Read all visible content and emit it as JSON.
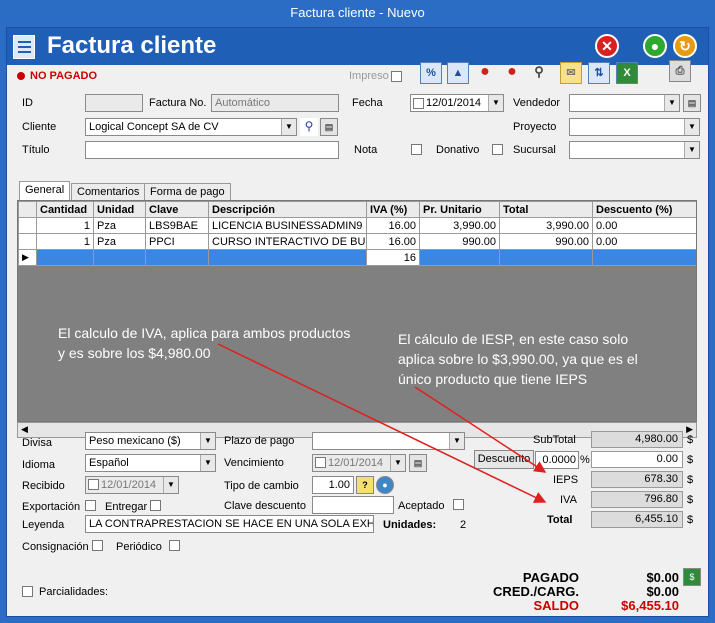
{
  "window": {
    "title": "Factura cliente - Nuevo"
  },
  "header": {
    "title": "Factura cliente",
    "close_glyph": "✕",
    "ok_glyph": "●",
    "refresh_glyph": "↻"
  },
  "status": {
    "label": "NO PAGADO",
    "color": "#cc0000"
  },
  "toolbar": {
    "impreso_label": "Impreso",
    "icons": [
      "percent-icon",
      "upload-icon",
      "red-ball-icon",
      "red-ball-icon",
      "binoculars-icon",
      "mail-icon",
      "transfer-icon",
      "excel-icon",
      "printer-icon"
    ]
  },
  "form": {
    "id_label": "ID",
    "id_value": "",
    "factura_no_label": "Factura No.",
    "factura_no_placeholder": "Automático",
    "fecha_label": "Fecha",
    "fecha_value": "12/01/2014",
    "vendedor_label": "Vendedor",
    "vendedor_value": "",
    "cliente_label": "Cliente",
    "cliente_value": "Logical Concept SA de CV",
    "proyecto_label": "Proyecto",
    "proyecto_value": "",
    "titulo_label": "Título",
    "titulo_value": "",
    "nota_label": "Nota",
    "donativo_label": "Donativo",
    "sucursal_label": "Sucursal",
    "sucursal_value": ""
  },
  "tabs": [
    {
      "label": "General"
    },
    {
      "label": "Comentarios"
    },
    {
      "label": "Forma de pago"
    }
  ],
  "grid": {
    "columns": [
      "Cantidad",
      "Unidad",
      "Clave",
      "Descripción",
      "IVA (%)",
      "Pr. Unitario",
      "Total",
      "Descuento (%)"
    ],
    "rows": [
      [
        "1",
        "Pza",
        "LBS9BAE",
        "LICENCIA BUSINESSADMIN9 ...",
        "16.00",
        "3,990.00",
        "3,990.00",
        "0.00"
      ],
      [
        "1",
        "Pza",
        "PPCI",
        "CURSO INTERACTIVO DE BU...",
        "16.00",
        "990.00",
        "990.00",
        "0.00"
      ]
    ],
    "new_row_iva": "16"
  },
  "annotations": {
    "iva_note": "El calculo de IVA, aplica para ambos productos y es sobre los $4,980.00",
    "ieps_note": "El cálculo de IESP, en este caso solo aplica sobre lo $3,990.00, ya que es el único producto que tiene IEPS",
    "arrow_color": "#e02020"
  },
  "footer": {
    "divisa_label": "Divisa",
    "divisa_value": "Peso mexicano ($)",
    "idioma_label": "Idioma",
    "idioma_value": "Español",
    "recibido_label": "Recibido",
    "recibido_value": "12/01/2014",
    "exportacion_label": "Exportación",
    "entregar_label": "Entregar",
    "leyenda_label": "Leyenda",
    "leyenda_value": "LA CONTRAPRESTACION SE HACE EN UNA SOLA EXHII",
    "consignacion_label": "Consignación",
    "periodico_label": "Periódico",
    "plazo_label": "Plazo de pago",
    "plazo_value": "",
    "vencimiento_label": "Vencimiento",
    "vencimiento_value": "12/01/2014",
    "tipo_cambio_label": "Tipo de cambio",
    "tipo_cambio_value": "1.00",
    "clave_desc_label": "Clave descuento",
    "clave_desc_value": "",
    "aceptado_label": "Aceptado",
    "unidades_label": "Unidades:",
    "unidades_value": "2",
    "parcialidades_label": "Parcialidades:"
  },
  "totals": {
    "subtotal_label": "SubTotal",
    "subtotal_value": "4,980.00",
    "descuento_button": "Descuento",
    "descuento_pct": "0.0000",
    "pct_sign": "%",
    "descuento_value": "0.00",
    "ieps_label": "IEPS",
    "ieps_value": "678.30",
    "iva_label": "IVA",
    "iva_value": "796.80",
    "total_label": "Total",
    "total_value": "6,455.10",
    "currency": "$"
  },
  "payment": {
    "pagado_label": "PAGADO",
    "pagado_value": "$0.00",
    "cred_label": "CRED./CARG.",
    "cred_value": "$0.00",
    "saldo_label": "SALDO",
    "saldo_value": "$6,455.10",
    "saldo_color": "#cc0000"
  }
}
